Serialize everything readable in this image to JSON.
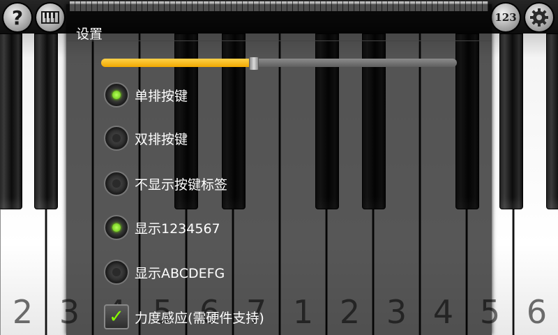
{
  "dialog": {
    "title": "设置",
    "volume_level": 0.43,
    "options": [
      {
        "label": "单排按键",
        "selected": true
      },
      {
        "label": "双排按键",
        "selected": false
      },
      {
        "label": "不显示按键标签",
        "selected": false
      },
      {
        "label": "显示1234567",
        "selected": true
      },
      {
        "label": "显示ABCDEFG",
        "selected": false
      }
    ],
    "checkbox": {
      "label": "力度感应(需硬件支持)",
      "checked": true,
      "mark": "✓"
    }
  },
  "toolbar": {
    "help_icon": "?",
    "number_label": "123"
  },
  "keyboard": {
    "white_labels": [
      "2",
      "3",
      "4",
      "5",
      "6",
      "7",
      "1",
      "2",
      "3",
      "4",
      "5",
      "6"
    ]
  },
  "colors": {
    "accent": "#f1a800",
    "radio_on": "#7fdc1a"
  }
}
